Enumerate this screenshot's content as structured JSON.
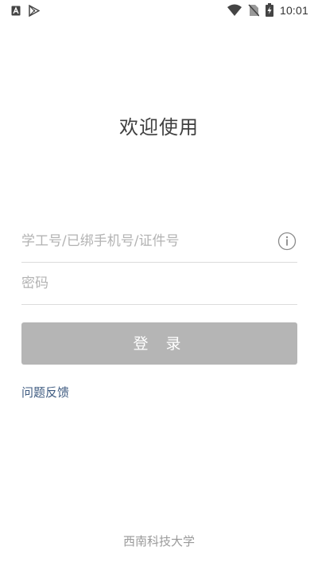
{
  "status_bar": {
    "time": "10:01",
    "left_icons": [
      "text-a-icon",
      "play-store-icon"
    ],
    "right_icons": [
      "wifi-icon",
      "no-sim-icon",
      "battery-charging-icon"
    ]
  },
  "welcome_title": "欢迎使用",
  "form": {
    "username_placeholder": "学工号/已绑手机号/证件号",
    "username_value": "",
    "password_placeholder": "密码",
    "password_value": "",
    "login_label": "登 录"
  },
  "feedback_label": "问题反馈",
  "footer_text": "西南科技大学",
  "colors": {
    "button_bg": "#b5b5b5",
    "link": "#3d5a80",
    "title": "#3f3f3f",
    "placeholder": "#b3b3b3"
  }
}
